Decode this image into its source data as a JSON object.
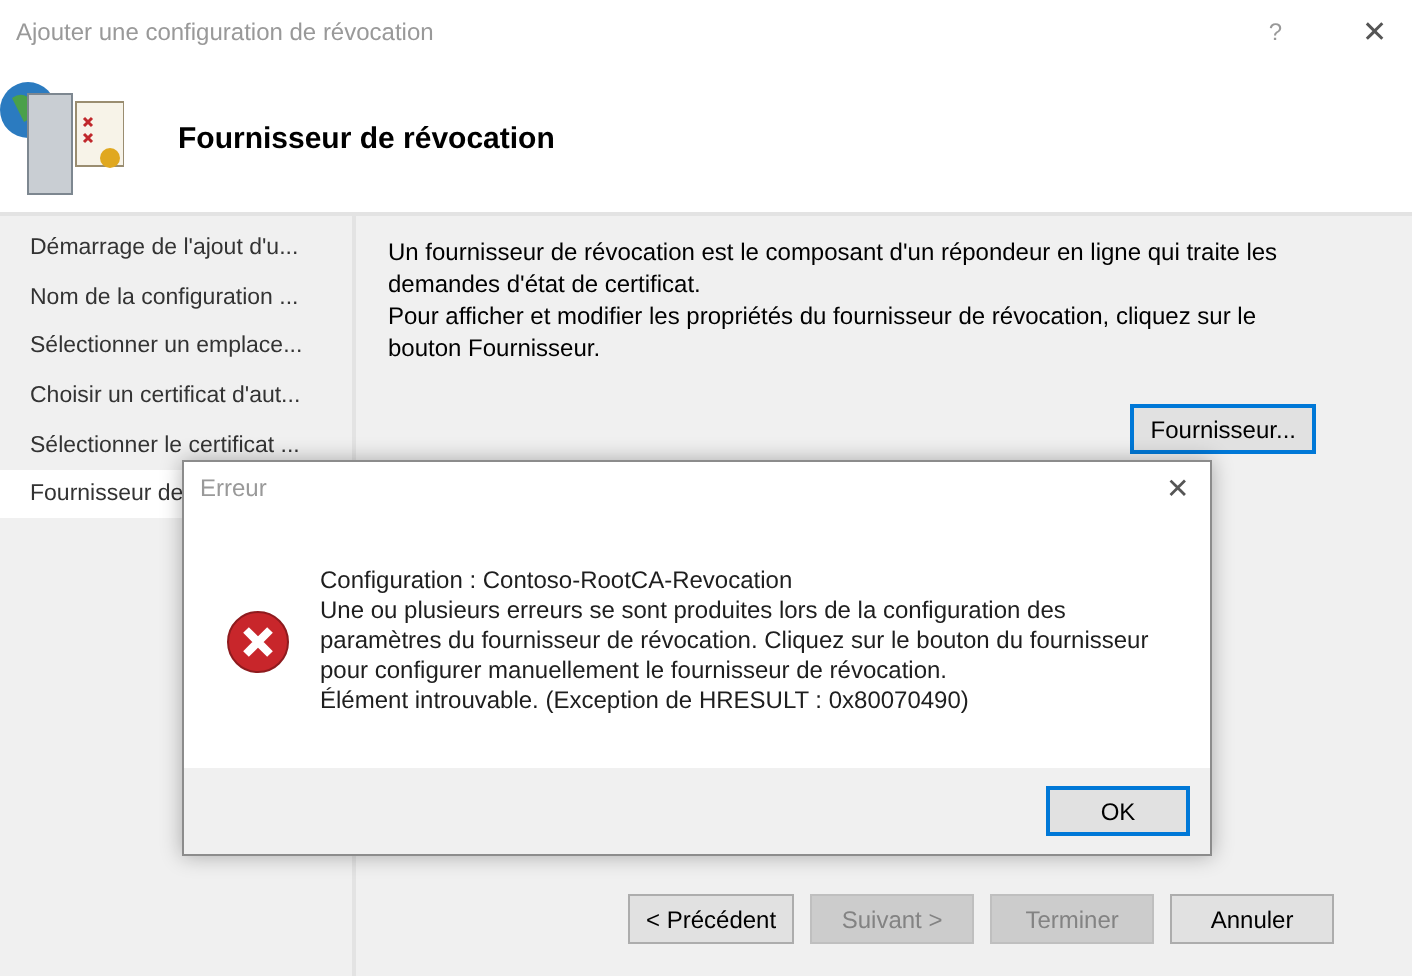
{
  "window": {
    "title": "Ajouter une configuration de révocation",
    "help": "?",
    "close": "✕"
  },
  "header": {
    "title": "Fournisseur de révocation"
  },
  "sidebar": {
    "items": [
      {
        "label": "Démarrage de l'ajout d'u...",
        "selected": false
      },
      {
        "label": "Nom de la configuration ...",
        "selected": false
      },
      {
        "label": "Sélectionner un emplace...",
        "selected": false
      },
      {
        "label": "Choisir un certificat d'aut...",
        "selected": false
      },
      {
        "label": "Sélectionner le certificat ...",
        "selected": false
      },
      {
        "label": "Fournisseur de",
        "selected": true
      }
    ]
  },
  "content": {
    "description": [
      "Un fournisseur de révocation est le composant d'un répondeur en ligne qui traite les demandes d'état de certificat.",
      "Pour afficher et modifier les propriétés du fournisseur de révocation, cliquez sur le bouton Fournisseur."
    ],
    "provider_button": {
      "label": "Fournisseur...",
      "focused": true
    }
  },
  "footer": {
    "buttons": [
      {
        "label": "< Précédent",
        "disabled": false
      },
      {
        "label": "Suivant >",
        "disabled": true
      },
      {
        "label": "Terminer",
        "disabled": true
      },
      {
        "label": "Annuler",
        "disabled": false
      }
    ]
  },
  "dialog": {
    "title": "Erreur",
    "close": "✕",
    "lines": [
      "Configuration : Contoso-RootCA-Revocation",
      "Une ou plusieurs erreurs se sont produites lors de la configuration des paramètres du fournisseur de révocation. Cliquez sur le bouton du fournisseur pour configurer manuellement le fournisseur de révocation.",
      "Élément introuvable. (Exception de HRESULT : 0x80070490)"
    ],
    "ok_button": {
      "label": "OK",
      "focused": true
    }
  }
}
